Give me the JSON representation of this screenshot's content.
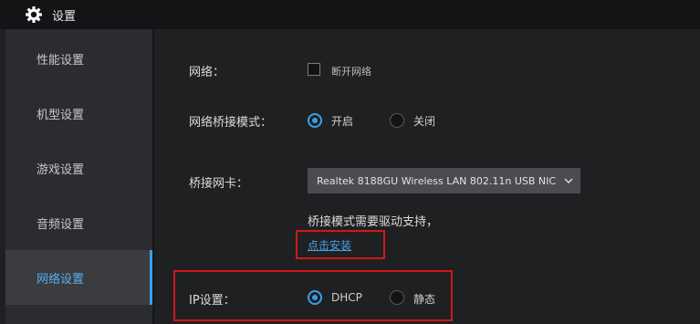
{
  "window": {
    "title": "设置",
    "title_icon": "gear-icon"
  },
  "sidebar": {
    "items": [
      {
        "label": "性能设置",
        "active": false
      },
      {
        "label": "机型设置",
        "active": false
      },
      {
        "label": "游戏设置",
        "active": false
      },
      {
        "label": "音频设置",
        "active": false
      },
      {
        "label": "网络设置",
        "active": true
      }
    ]
  },
  "network": {
    "label": "网络：",
    "disconnect_label": "断开网络",
    "disconnect_checked": false
  },
  "bridge_mode": {
    "label": "网络桥接模式：",
    "options": [
      {
        "label": "开启",
        "selected": true
      },
      {
        "label": "关闭",
        "selected": false
      }
    ]
  },
  "bridge_nic": {
    "label": "桥接网卡：",
    "selected_value": "Realtek 8188GU Wireless LAN 802.11n USB NIC"
  },
  "driver_hint": {
    "text": "桥接模式需要驱动支持，",
    "link": "点击安装"
  },
  "ip_settings": {
    "label": "IP设置：",
    "options": [
      {
        "label": "DHCP",
        "selected": true
      },
      {
        "label": "静态",
        "selected": false
      }
    ]
  },
  "colors": {
    "accent": "#3aa0e6",
    "highlight_box": "#d01818",
    "background": "#1f2022",
    "sidebar": "#2b2c2f",
    "titlebar": "#131416"
  }
}
